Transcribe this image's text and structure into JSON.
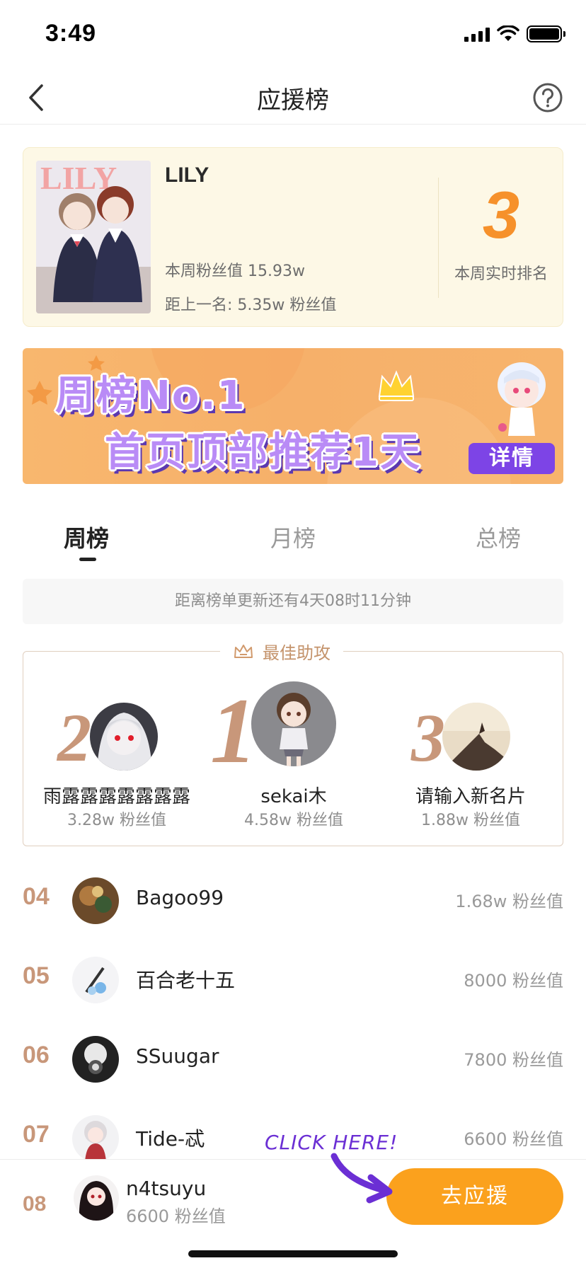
{
  "status_bar": {
    "time": "3:49"
  },
  "nav": {
    "title": "应援榜"
  },
  "work": {
    "title": "LILY",
    "weekly_fan_value": "本周粉丝值 15.93w",
    "gap_to_previous": "距上一名: 5.35w 粉丝值",
    "rank": "3",
    "rank_label": "本周实时排名",
    "cover_text": "LILY"
  },
  "banner": {
    "line1": "周榜No.1",
    "line2": "首页顶部推荐1天",
    "detail_label": "详情"
  },
  "tabs": [
    {
      "label": "周榜",
      "active": true
    },
    {
      "label": "月榜",
      "active": false
    },
    {
      "label": "总榜",
      "active": false
    }
  ],
  "countdown": "距离榜单更新还有4天08时11分钟",
  "best_assist": {
    "title": "最佳助攻",
    "podium": [
      {
        "rank": "2",
        "name": "雨露露露露露露露",
        "value": "3.28w 粉丝值"
      },
      {
        "rank": "1",
        "name": "sekai木",
        "value": "4.58w 粉丝值"
      },
      {
        "rank": "3",
        "name": "请输入新名片",
        "value": "1.88w 粉丝值"
      }
    ]
  },
  "ranking_list": [
    {
      "rank": "04",
      "name": "Bagoo99",
      "value": "1.68w 粉丝值"
    },
    {
      "rank": "05",
      "name": "百合老十五",
      "value": "8000 粉丝值"
    },
    {
      "rank": "06",
      "name": "SSuugar",
      "value": "7800 粉丝值"
    },
    {
      "rank": "07",
      "name": "Tide-忒",
      "value": "6600 粉丝值"
    }
  ],
  "me": {
    "rank": "08",
    "name": "n4tsuyu",
    "value": "6600 粉丝值",
    "support_label": "去应援"
  },
  "annotation": {
    "hint": "CLICK HERE!",
    "color": "#6b2fd4"
  },
  "colors": {
    "accent": "#fba11d",
    "rank_number": "#f6912b",
    "rank_gold": "#c8977a",
    "banner_button": "#7d44e6"
  }
}
